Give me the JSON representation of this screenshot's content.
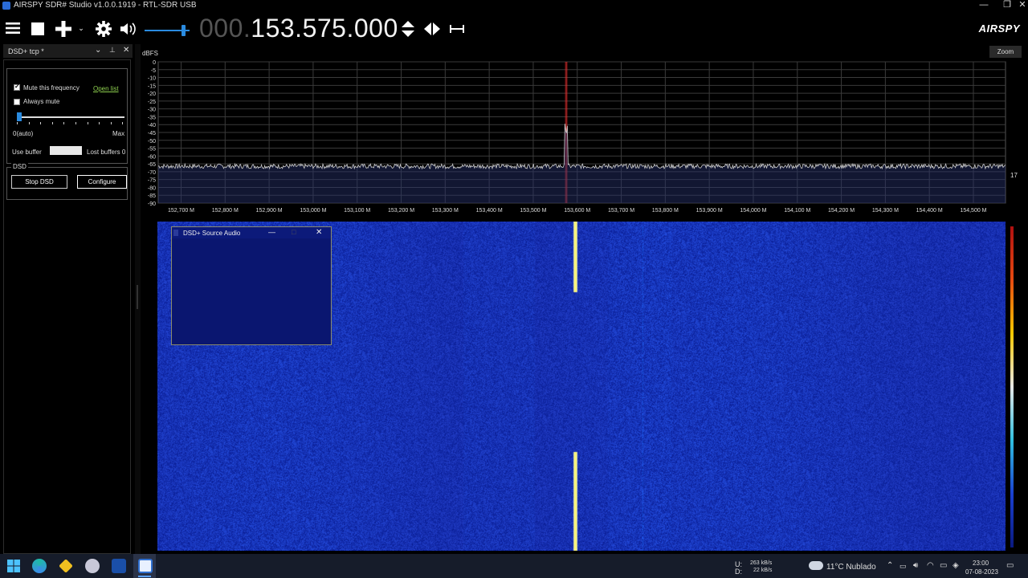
{
  "window": {
    "title": "AIRSPY SDR# Studio v1.0.0.1919 - RTL-SDR USB",
    "controls": {
      "minimize": "—",
      "maximize": "❐",
      "close": "✕"
    }
  },
  "toolbar": {
    "menu_icon": "menu-icon",
    "stop_icon": "stop-icon",
    "add_icon": "plus-icon",
    "settings_icon": "gear-icon",
    "audio_icon": "speaker-icon",
    "volume": 0.9,
    "frequency_dim": "000.",
    "frequency_lit": "153.575.000",
    "brand": "AIRSPY"
  },
  "panel": {
    "title": "DSD+ tcp *",
    "mute_frequency_label": "Mute this frequency",
    "mute_frequency_checked": true,
    "open_list_label": "Open list",
    "always_mute_label": "Always mute",
    "always_mute_checked": false,
    "slider_min_label": "0(auto)",
    "slider_max_label": "Max",
    "slider_value": 0.0,
    "use_buffer_label": "Use buffer",
    "lost_buffers_label": "Lost buffers 0",
    "dsd_group_label": "DSD",
    "stop_dsd_label": "Stop DSD",
    "configure_label": "Configure"
  },
  "spectrum": {
    "unit_label": "dBFS",
    "zoom_label": "Zoom",
    "right_value": "17",
    "y_ticks": [
      "0",
      "-5",
      "-10",
      "-15",
      "-20",
      "-25",
      "-30",
      "-35",
      "-40",
      "-45",
      "-50",
      "-55",
      "-60",
      "-65",
      "-70",
      "-75",
      "-80",
      "-85",
      "-90"
    ],
    "x_ticks": [
      "152,700 M",
      "152,800 M",
      "152,900 M",
      "153,000 M",
      "153,100 M",
      "153,200 M",
      "153,300 M",
      "153,400 M",
      "153,500 M",
      "153,600 M",
      "153,700 M",
      "153,800 M",
      "153,900 M",
      "154,000 M",
      "154,100 M",
      "154,200 M",
      "154,300 M",
      "154,400 M",
      "154,500 M"
    ]
  },
  "chart_data": {
    "type": "line",
    "x_unit": "MHz",
    "xlim": [
      152.648,
      154.573
    ],
    "ylim": [
      -90,
      0
    ],
    "ylabel": "dBFS",
    "noise_floor": -65,
    "tuned_frequency": 153.575,
    "peak": {
      "x": 153.575,
      "y": -47
    }
  },
  "popup": {
    "title": "DSD+ Source Audio",
    "minimize": "—",
    "maximize": "□",
    "close": "✕"
  },
  "taskbar": {
    "upload": "263 kB/s",
    "download": "22 kB/s",
    "upload_label": "U:",
    "download_label": "D:",
    "weather": "11°C  Nublado",
    "time": "23:00",
    "date": "07-08-2023"
  }
}
